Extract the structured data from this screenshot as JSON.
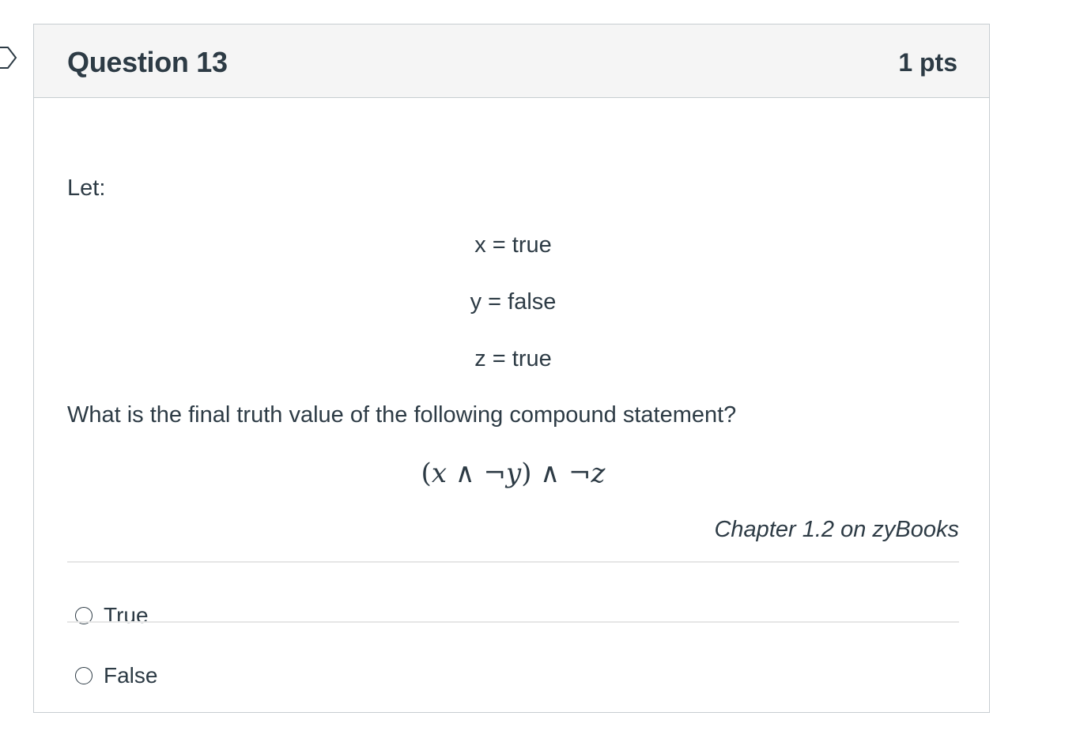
{
  "question": {
    "title": "Question 13",
    "points": "1 pts",
    "intro": "Let:",
    "assignments": [
      {
        "text": "x = true"
      },
      {
        "text": "y = false"
      },
      {
        "text": "z = true"
      }
    ],
    "prompt": "What is the final truth value of the following compound statement?",
    "formula": {
      "open_paren": "(",
      "var_x": "x",
      "and_1": " ∧ ",
      "not_1": "¬",
      "var_y": "y",
      "close_paren": ")",
      "and_2": " ∧ ",
      "not_2": "¬",
      "var_z": "z"
    },
    "reference": "Chapter 1.2 on zyBooks",
    "answers": [
      {
        "label": "True"
      },
      {
        "label": "False"
      }
    ]
  },
  "icons": {
    "flag": "flag-question-icon"
  }
}
